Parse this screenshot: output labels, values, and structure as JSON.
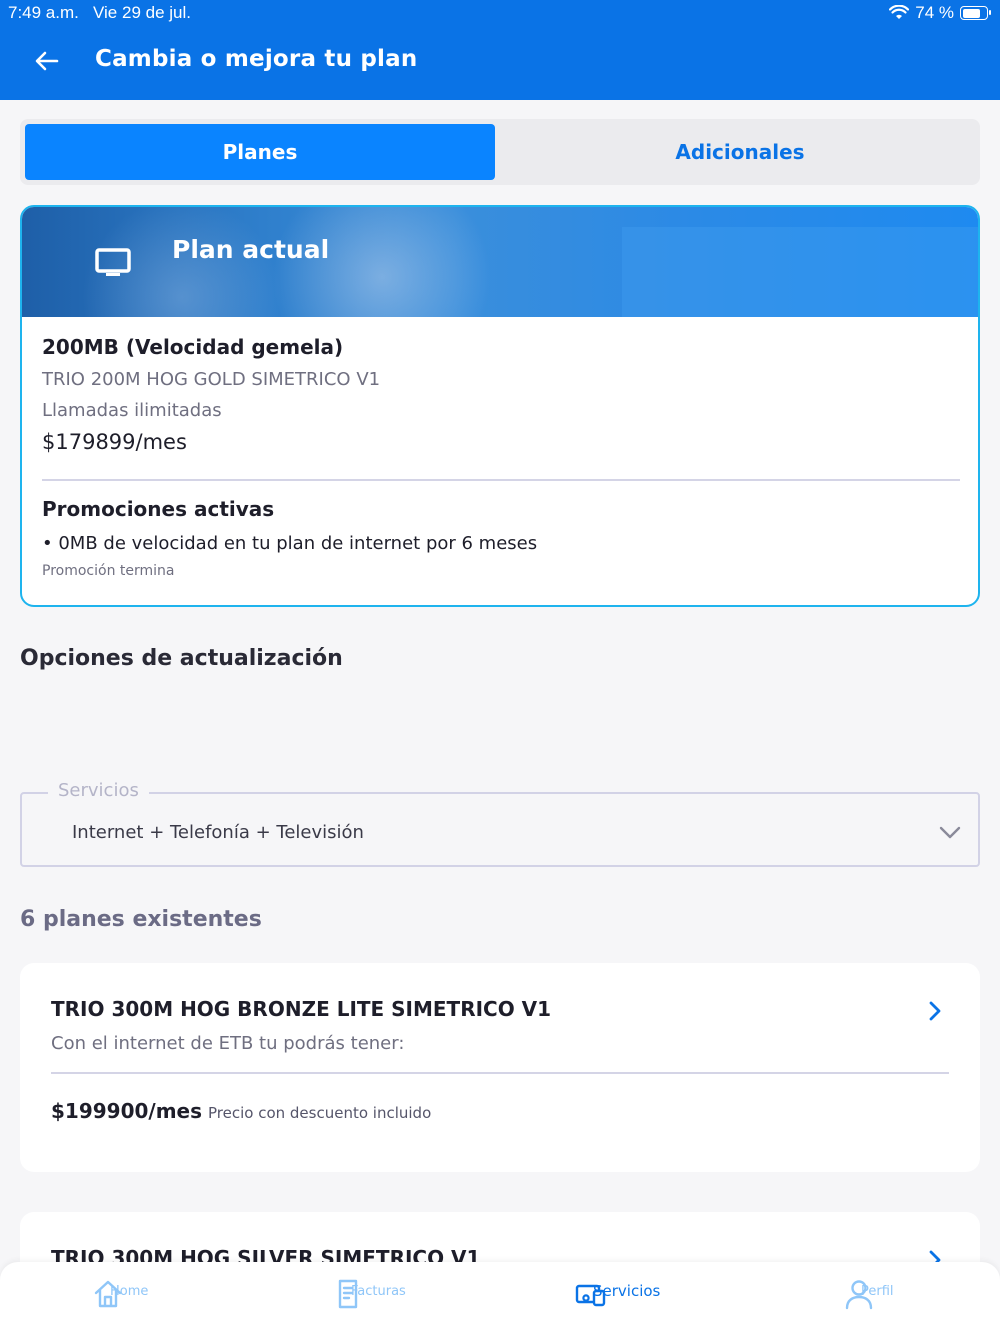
{
  "status_bar": {
    "time": "7:49 a.m.",
    "date": "Vie 29 de jul.",
    "battery": "74 %",
    "battery_level": 0.74
  },
  "header": {
    "title": "Cambia o mejora tu plan"
  },
  "tabs": [
    {
      "label": "Planes",
      "active": true
    },
    {
      "label": "Adicionales",
      "active": false
    }
  ],
  "current_plan": {
    "banner_title": "Plan actual",
    "name": "200MB (Velocidad gemela)",
    "code": "TRIO 200M HOG GOLD SIMETRICO V1",
    "calls": "Llamadas ilimitadas",
    "price": "$179899/mes",
    "promotions_title": "Promociones activas",
    "promotion_item": "• 0MB de velocidad en tu plan de internet por 6 meses",
    "promotion_end": "Promoción termina"
  },
  "upgrade": {
    "section_title": "Opciones de actualización",
    "select_label": "Servicios",
    "select_value": "Internet + Telefonía + Televisión",
    "count_label": "6 planes existentes"
  },
  "offers": [
    {
      "name": "TRIO 300M HOG BRONZE LITE SIMETRICO V1",
      "description": "Con el internet de ETB tu podrás tener:",
      "price": "$199900/mes",
      "note": "Precio con descuento incluido"
    },
    {
      "name": "TRIO 300M HOG SILVER SIMETRICO V1"
    }
  ],
  "bottom_nav": [
    {
      "label": "Home",
      "icon": "home-icon",
      "active": false
    },
    {
      "label": "Facturas",
      "icon": "bills-icon",
      "active": false
    },
    {
      "label": "Servicios",
      "icon": "services-icon",
      "active": true
    },
    {
      "label": "Perfil",
      "icon": "profile-icon",
      "active": false
    }
  ],
  "colors": {
    "primary": "#0a73e6",
    "tab_active": "#0a84ff",
    "card_border": "#1eb4ee",
    "nav_inactive": "#8fc6f8"
  }
}
